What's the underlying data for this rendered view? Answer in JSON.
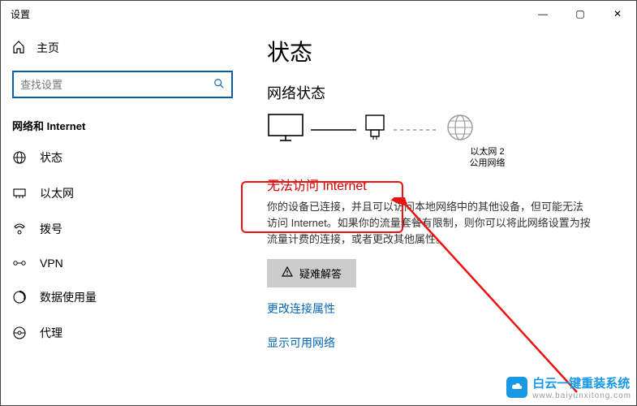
{
  "window": {
    "title": "设置",
    "controls": {
      "min": "—",
      "max": "▢",
      "close": "✕"
    }
  },
  "sidebar": {
    "home": "主页",
    "search_placeholder": "查找设置",
    "section": "网络和 Internet",
    "items": [
      {
        "label": "状态"
      },
      {
        "label": "以太网"
      },
      {
        "label": "拨号"
      },
      {
        "label": "VPN"
      },
      {
        "label": "数据使用量"
      },
      {
        "label": "代理"
      }
    ]
  },
  "main": {
    "page_title": "状态",
    "sub_title": "网络状态",
    "diagram": {
      "adapter_name": "以太网 2",
      "adapter_type": "公用网络"
    },
    "status_line": "无法访问 Internet",
    "description": "你的设备已连接，并且可以访问本地网络中的其他设备，但可能无法访问 Internet。如果你的流量套餐有限制，则你可以将此网络设置为按流量计费的连接，或者更改其他属性。",
    "troubleshoot": "疑难解答",
    "link_change": "更改连接属性",
    "link_show": "显示可用网络"
  },
  "watermark": {
    "brand": "白云一键重装系统",
    "url": "www.baiyunxitong.com"
  }
}
